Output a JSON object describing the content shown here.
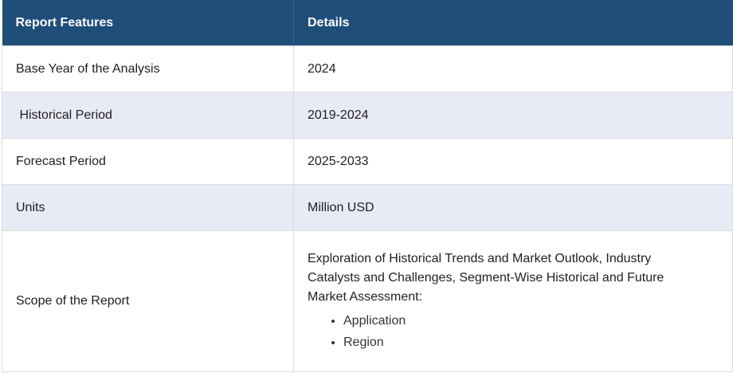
{
  "table": {
    "headers": [
      "Report Features",
      "Details"
    ],
    "rows": [
      {
        "feature": "Base Year of the Analysis",
        "details": "2024"
      },
      {
        "feature": " Historical Period",
        "details": "2019-2024"
      },
      {
        "feature": "Forecast Period",
        "details": "2025-2033"
      },
      {
        "feature": "Units",
        "details": "Million USD"
      }
    ],
    "scope": {
      "feature": "Scope of the Report",
      "details_text": "Exploration of Historical Trends and Market Outlook, Industry Catalysts and Challenges, Segment-Wise Historical and Future Market Assessment:",
      "bullets": [
        "Application",
        "Region"
      ]
    }
  },
  "colors": {
    "header_bg": "#1f4e79",
    "alt_row_bg": "#e8eaf6"
  }
}
